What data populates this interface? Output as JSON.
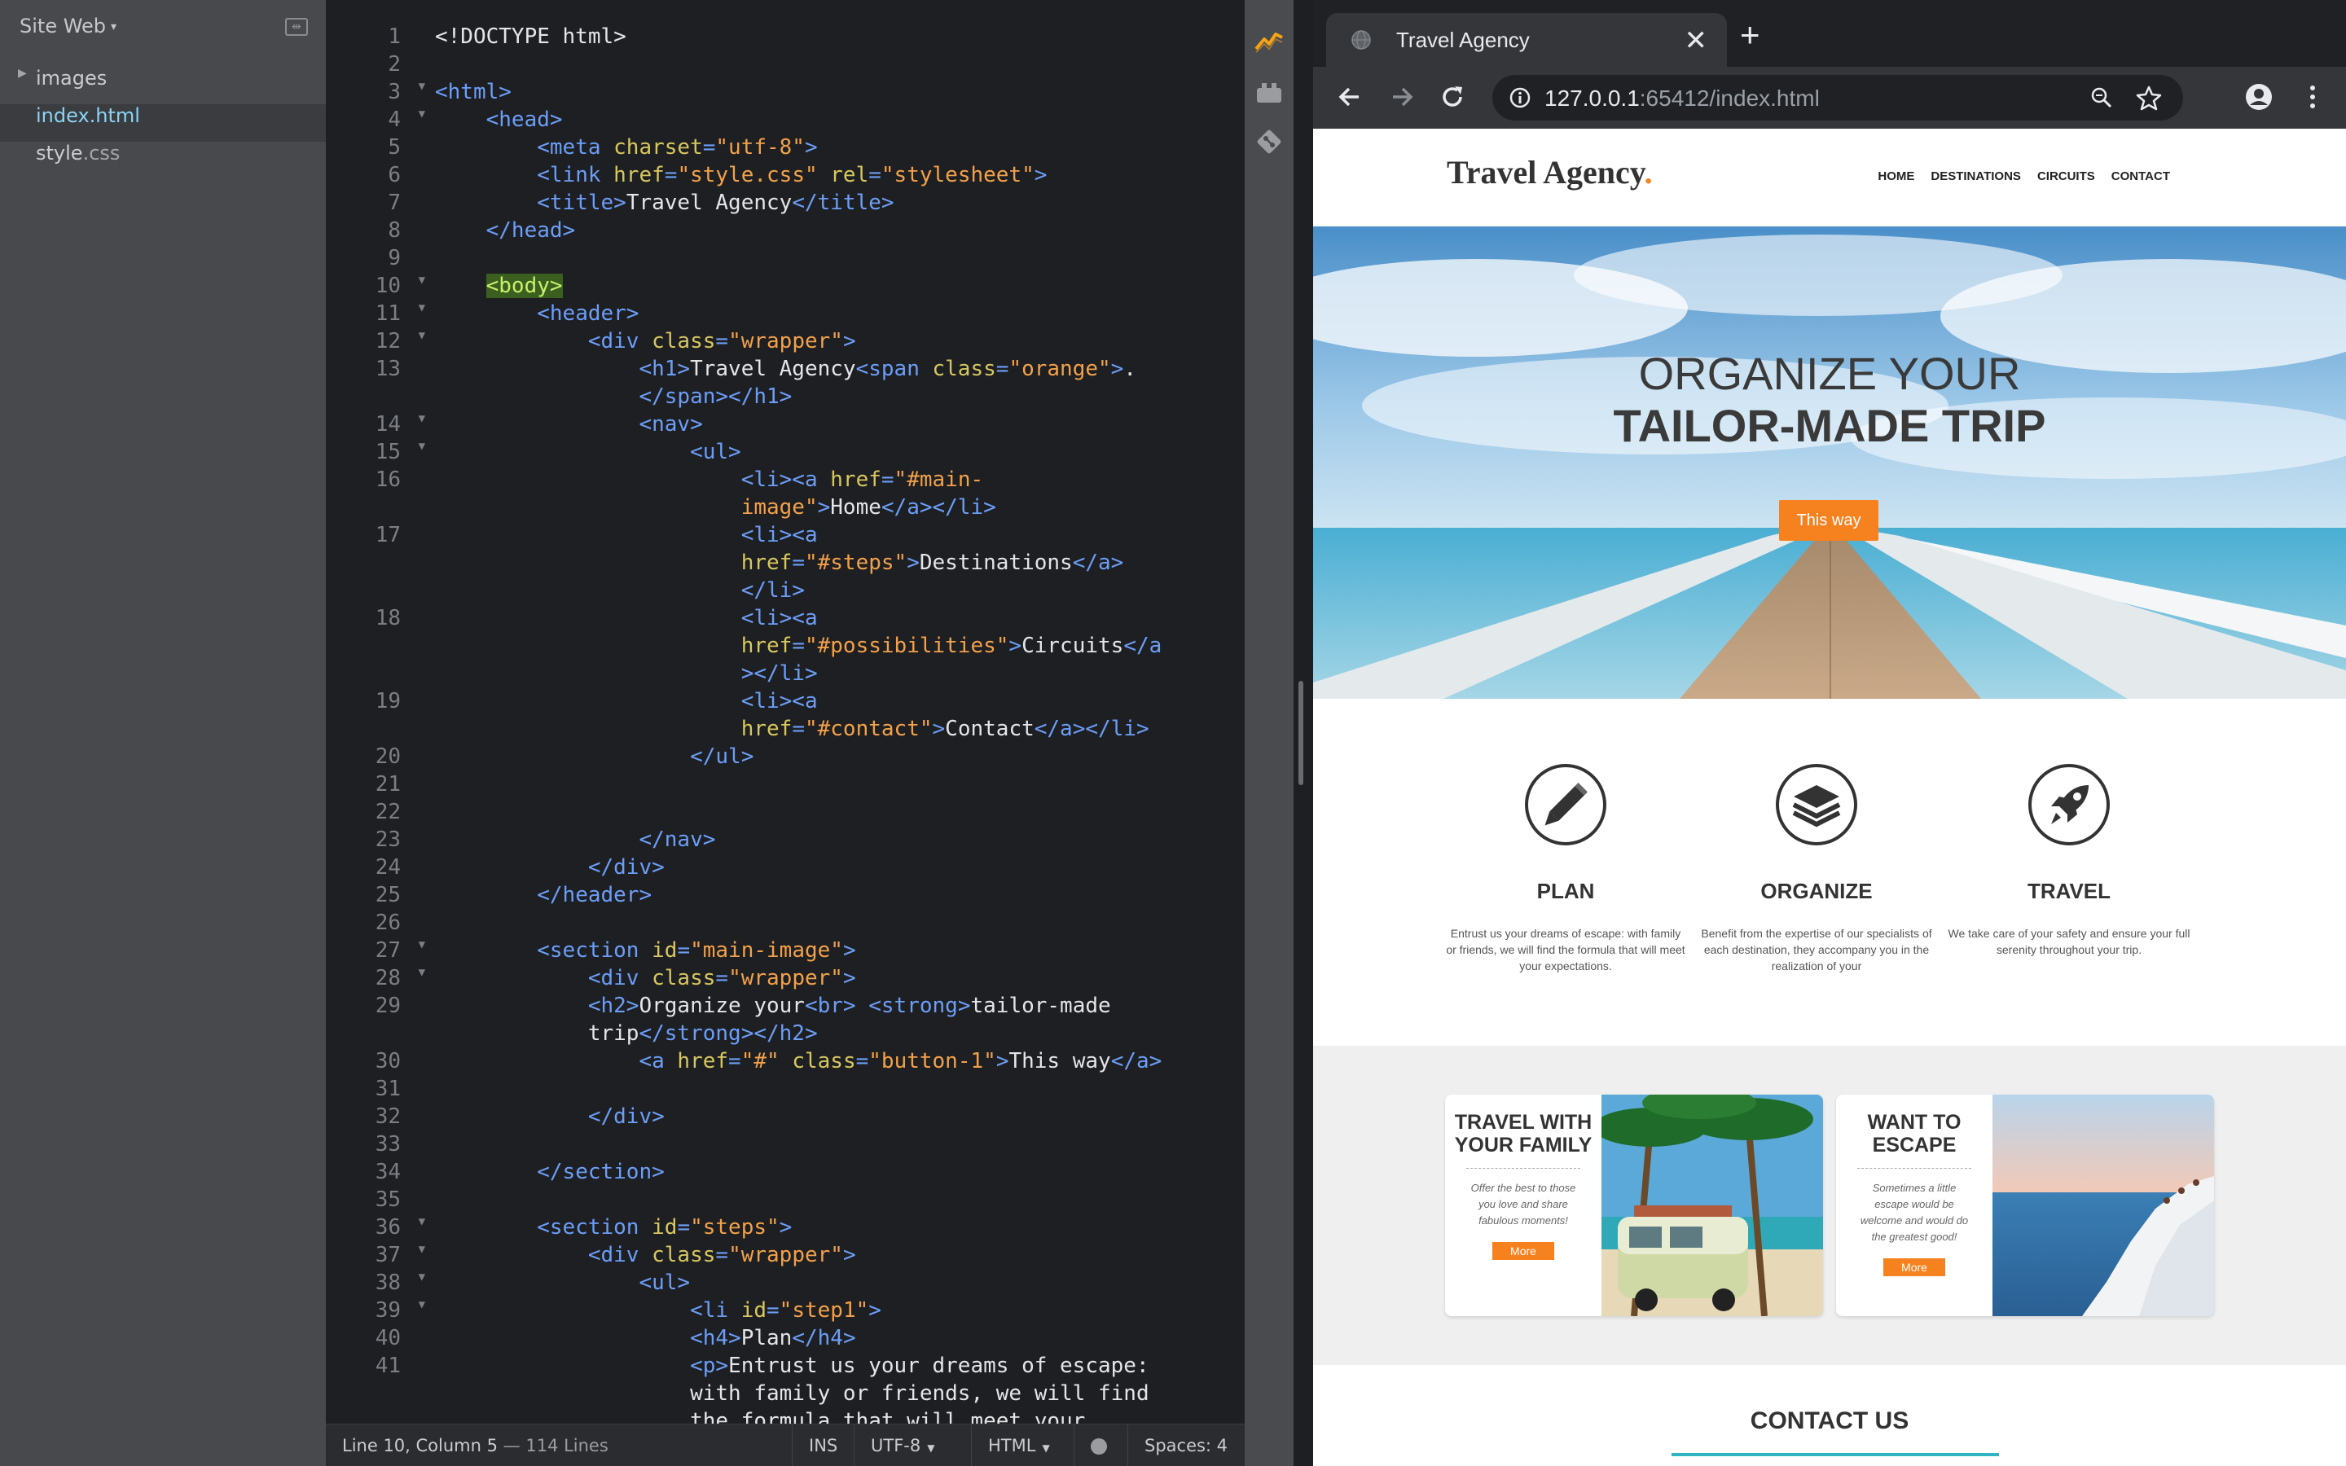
{
  "sidebar": {
    "project": "Site Web",
    "items": [
      {
        "label": "images",
        "type": "folder"
      },
      {
        "label": "index.html",
        "type": "file",
        "active": true
      },
      {
        "label": "style",
        "ext": ".css",
        "type": "file"
      }
    ]
  },
  "editor": {
    "lines": [
      {
        "n": "1",
        "segs": [
          [
            "",
            "<!DOCTYPE html>"
          ]
        ]
      },
      {
        "n": "2",
        "segs": []
      },
      {
        "n": "3",
        "fold": true,
        "segs": [
          [
            "t",
            "<html>"
          ]
        ]
      },
      {
        "n": "4",
        "fold": true,
        "segs": [
          [
            "",
            "    "
          ],
          [
            "t",
            "<head>"
          ]
        ]
      },
      {
        "n": "5",
        "segs": [
          [
            "",
            "        "
          ],
          [
            "t",
            "<meta "
          ],
          [
            "a",
            "charset"
          ],
          [
            "t",
            "="
          ],
          [
            "s",
            "\"utf-8\""
          ],
          [
            "t",
            ">"
          ]
        ]
      },
      {
        "n": "6",
        "segs": [
          [
            "",
            "        "
          ],
          [
            "t",
            "<link "
          ],
          [
            "a",
            "href"
          ],
          [
            "t",
            "="
          ],
          [
            "s",
            "\"style.css\""
          ],
          [
            "t",
            " "
          ],
          [
            "a",
            "rel"
          ],
          [
            "t",
            "="
          ],
          [
            "s",
            "\"stylesheet\""
          ],
          [
            "t",
            ">"
          ]
        ]
      },
      {
        "n": "7",
        "segs": [
          [
            "",
            "        "
          ],
          [
            "t",
            "<title>"
          ],
          [
            "",
            "Travel Agency"
          ],
          [
            "t",
            "</title>"
          ]
        ]
      },
      {
        "n": "8",
        "segs": [
          [
            "",
            "    "
          ],
          [
            "t",
            "</head>"
          ]
        ]
      },
      {
        "n": "9",
        "segs": []
      },
      {
        "n": "10",
        "fold": true,
        "segs": [
          [
            "",
            "    "
          ],
          [
            "sel",
            "<body>"
          ]
        ]
      },
      {
        "n": "11",
        "fold": true,
        "segs": [
          [
            "",
            "        "
          ],
          [
            "t",
            "<header>"
          ]
        ]
      },
      {
        "n": "12",
        "fold": true,
        "segs": [
          [
            "",
            "            "
          ],
          [
            "t",
            "<div "
          ],
          [
            "a",
            "class"
          ],
          [
            "t",
            "="
          ],
          [
            "s",
            "\"wrapper\""
          ],
          [
            "t",
            ">"
          ]
        ]
      },
      {
        "n": "13",
        "segs": [
          [
            "",
            "                "
          ],
          [
            "t",
            "<h1>"
          ],
          [
            "",
            "Travel Agency"
          ],
          [
            "t",
            "<span "
          ],
          [
            "a",
            "class"
          ],
          [
            "t",
            "="
          ],
          [
            "s",
            "\"orange\""
          ],
          [
            "t",
            ">"
          ],
          [
            "",
            "."
          ]
        ]
      },
      {
        "n": "",
        "segs": [
          [
            "",
            "                "
          ],
          [
            "t",
            "</span></h1>"
          ]
        ]
      },
      {
        "n": "14",
        "fold": true,
        "segs": [
          [
            "",
            "                "
          ],
          [
            "t",
            "<nav>"
          ]
        ]
      },
      {
        "n": "15",
        "fold": true,
        "segs": [
          [
            "",
            "                    "
          ],
          [
            "t",
            "<ul>"
          ]
        ]
      },
      {
        "n": "16",
        "segs": [
          [
            "",
            "                        "
          ],
          [
            "t",
            "<li><a "
          ],
          [
            "a",
            "href"
          ],
          [
            "t",
            "="
          ],
          [
            "s",
            "\"#main-"
          ]
        ]
      },
      {
        "n": "",
        "segs": [
          [
            "",
            "                        "
          ],
          [
            "s",
            "image\""
          ],
          [
            "t",
            ">"
          ],
          [
            "",
            "Home"
          ],
          [
            "t",
            "</a></li>"
          ]
        ]
      },
      {
        "n": "17",
        "segs": [
          [
            "",
            "                        "
          ],
          [
            "t",
            "<li><a"
          ]
        ]
      },
      {
        "n": "",
        "segs": [
          [
            "",
            "                        "
          ],
          [
            "a",
            "href"
          ],
          [
            "t",
            "="
          ],
          [
            "s",
            "\"#steps\""
          ],
          [
            "t",
            ">"
          ],
          [
            "",
            "Destinations"
          ],
          [
            "t",
            "</a>"
          ]
        ]
      },
      {
        "n": "",
        "segs": [
          [
            "",
            "                        "
          ],
          [
            "t",
            "</li>"
          ]
        ]
      },
      {
        "n": "18",
        "segs": [
          [
            "",
            "                        "
          ],
          [
            "t",
            "<li><a"
          ]
        ]
      },
      {
        "n": "",
        "segs": [
          [
            "",
            "                        "
          ],
          [
            "a",
            "href"
          ],
          [
            "t",
            "="
          ],
          [
            "s",
            "\"#possibilities\""
          ],
          [
            "t",
            ">"
          ],
          [
            "",
            "Circuits"
          ],
          [
            "t",
            "</a"
          ]
        ]
      },
      {
        "n": "",
        "segs": [
          [
            "",
            "                        "
          ],
          [
            "t",
            "></li>"
          ]
        ]
      },
      {
        "n": "19",
        "segs": [
          [
            "",
            "                        "
          ],
          [
            "t",
            "<li><a"
          ]
        ]
      },
      {
        "n": "",
        "segs": [
          [
            "",
            "                        "
          ],
          [
            "a",
            "href"
          ],
          [
            "t",
            "="
          ],
          [
            "s",
            "\"#contact\""
          ],
          [
            "t",
            ">"
          ],
          [
            "",
            "Contact"
          ],
          [
            "t",
            "</a></li>"
          ]
        ]
      },
      {
        "n": "20",
        "segs": [
          [
            "",
            "                    "
          ],
          [
            "t",
            "</ul>"
          ]
        ]
      },
      {
        "n": "21",
        "segs": []
      },
      {
        "n": "22",
        "segs": []
      },
      {
        "n": "23",
        "segs": [
          [
            "",
            "                "
          ],
          [
            "t",
            "</nav>"
          ]
        ]
      },
      {
        "n": "24",
        "segs": [
          [
            "",
            "            "
          ],
          [
            "t",
            "</div>"
          ]
        ]
      },
      {
        "n": "25",
        "segs": [
          [
            "",
            "        "
          ],
          [
            "t",
            "</header>"
          ]
        ]
      },
      {
        "n": "26",
        "segs": []
      },
      {
        "n": "27",
        "fold": true,
        "segs": [
          [
            "",
            "        "
          ],
          [
            "t",
            "<section "
          ],
          [
            "a",
            "id"
          ],
          [
            "t",
            "="
          ],
          [
            "s",
            "\"main-image\""
          ],
          [
            "t",
            ">"
          ]
        ]
      },
      {
        "n": "28",
        "fold": true,
        "segs": [
          [
            "",
            "            "
          ],
          [
            "t",
            "<div "
          ],
          [
            "a",
            "class"
          ],
          [
            "t",
            "="
          ],
          [
            "s",
            "\"wrapper\""
          ],
          [
            "t",
            ">"
          ]
        ]
      },
      {
        "n": "29",
        "segs": [
          [
            "",
            "            "
          ],
          [
            "t",
            "<h2>"
          ],
          [
            "",
            "Organize your"
          ],
          [
            "t",
            "<br>"
          ],
          [
            "",
            " "
          ],
          [
            "t",
            "<strong>"
          ],
          [
            "",
            "tailor-made"
          ]
        ]
      },
      {
        "n": "",
        "segs": [
          [
            "",
            "            "
          ],
          [
            "",
            "trip"
          ],
          [
            "t",
            "</strong></h2>"
          ]
        ]
      },
      {
        "n": "30",
        "segs": [
          [
            "",
            "                "
          ],
          [
            "t",
            "<a "
          ],
          [
            "a",
            "href"
          ],
          [
            "t",
            "="
          ],
          [
            "s",
            "\"#\""
          ],
          [
            "t",
            " "
          ],
          [
            "a",
            "class"
          ],
          [
            "t",
            "="
          ],
          [
            "s",
            "\"button-1\""
          ],
          [
            "t",
            ">"
          ],
          [
            "",
            "This way"
          ],
          [
            "t",
            "</a>"
          ]
        ]
      },
      {
        "n": "31",
        "segs": []
      },
      {
        "n": "32",
        "segs": [
          [
            "",
            "            "
          ],
          [
            "t",
            "</div>"
          ]
        ]
      },
      {
        "n": "33",
        "segs": []
      },
      {
        "n": "34",
        "segs": [
          [
            "",
            "        "
          ],
          [
            "t",
            "</section>"
          ]
        ]
      },
      {
        "n": "35",
        "segs": []
      },
      {
        "n": "36",
        "fold": true,
        "segs": [
          [
            "",
            "        "
          ],
          [
            "t",
            "<section "
          ],
          [
            "a",
            "id"
          ],
          [
            "t",
            "="
          ],
          [
            "s",
            "\"steps\""
          ],
          [
            "t",
            ">"
          ]
        ]
      },
      {
        "n": "37",
        "fold": true,
        "segs": [
          [
            "",
            "            "
          ],
          [
            "t",
            "<div "
          ],
          [
            "a",
            "class"
          ],
          [
            "t",
            "="
          ],
          [
            "s",
            "\"wrapper\""
          ],
          [
            "t",
            ">"
          ]
        ]
      },
      {
        "n": "38",
        "fold": true,
        "segs": [
          [
            "",
            "                "
          ],
          [
            "t",
            "<ul>"
          ]
        ]
      },
      {
        "n": "39",
        "fold": true,
        "segs": [
          [
            "",
            "                    "
          ],
          [
            "t",
            "<li "
          ],
          [
            "a",
            "id"
          ],
          [
            "t",
            "="
          ],
          [
            "s",
            "\"step1\""
          ],
          [
            "t",
            ">"
          ]
        ]
      },
      {
        "n": "40",
        "segs": [
          [
            "",
            "                    "
          ],
          [
            "t",
            "<h4>"
          ],
          [
            "",
            "Plan"
          ],
          [
            "t",
            "</h4>"
          ]
        ]
      },
      {
        "n": "41",
        "segs": [
          [
            "",
            "                    "
          ],
          [
            "t",
            "<p>"
          ],
          [
            "",
            "Entrust us your dreams of escape:"
          ]
        ]
      },
      {
        "n": "",
        "segs": [
          [
            "",
            "                    "
          ],
          [
            "",
            "with family or friends, we will find"
          ]
        ]
      },
      {
        "n": "",
        "segs": [
          [
            "",
            "                    "
          ],
          [
            "",
            "the formula that will meet your"
          ]
        ]
      }
    ]
  },
  "statusbar": {
    "cursor": "Line 10, Column 5",
    "lines": "114 Lines",
    "mode": "INS",
    "encoding": "UTF-8",
    "language": "HTML",
    "spaces": "Spaces: 4"
  },
  "browser": {
    "tab_title": "Travel Agency",
    "url_host": "127.0.0.1",
    "url_rest": ":65412/index.html"
  },
  "site": {
    "logo": "Travel Agency",
    "logo_dot": ".",
    "nav": [
      "HOME",
      "DESTINATIONS",
      "CIRCUITS",
      "CONTACT"
    ],
    "hero_line1": "ORGANIZE YOUR",
    "hero_line2": "TAILOR-MADE TRIP",
    "hero_button": "This way",
    "steps": [
      {
        "title": "PLAN",
        "text": "Entrust us your dreams of escape: with family or friends, we will find the formula that will meet your expectations.",
        "icon": "pencil-icon"
      },
      {
        "title": "ORGANIZE",
        "text": "Benefit from the expertise of our specialists of each destination, they accompany you in the realization of your",
        "icon": "layers-icon"
      },
      {
        "title": "TRAVEL",
        "text": "We take care of your safety and ensure your full serenity throughout your trip.",
        "icon": "rocket-icon"
      }
    ],
    "cards": [
      {
        "title": "TRAVEL WITH YOUR FAMILY",
        "text": "Offer the best to those you love and share fabulous moments!",
        "button": "More"
      },
      {
        "title": "WANT TO ESCAPE",
        "text": "Sometimes a little escape would be welcome and would do the greatest good!",
        "button": "More"
      }
    ],
    "contact_title": "CONTACT US"
  },
  "colors": {
    "accent_orange": "#f6821f",
    "contact_bar": "#2fb4c3",
    "active_file": "#8ad3f5"
  }
}
